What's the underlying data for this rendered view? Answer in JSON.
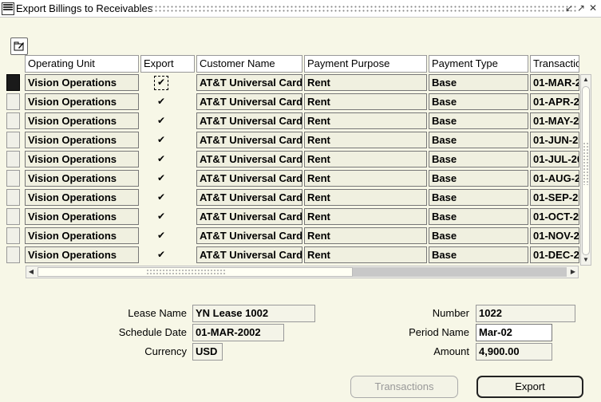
{
  "window": {
    "title": "Export Billings to Receivables",
    "minimize_glyph": "↙",
    "maximize_glyph": "↗",
    "close_glyph": "✕"
  },
  "toolbar": {
    "folder_icon": "folder-tools-icon"
  },
  "table": {
    "columns": [
      "Operating Unit",
      "Export",
      "Customer Name",
      "Payment Purpose",
      "Payment Type",
      "Transactio"
    ],
    "rows": [
      {
        "operating_unit": "Vision Operations",
        "export": true,
        "customer_name": "AT&T Universal Card",
        "payment_purpose": "Rent",
        "payment_type": "Base",
        "transaction_date": "01-MAR-2"
      },
      {
        "operating_unit": "Vision Operations",
        "export": true,
        "customer_name": "AT&T Universal Card",
        "payment_purpose": "Rent",
        "payment_type": "Base",
        "transaction_date": "01-APR-20"
      },
      {
        "operating_unit": "Vision Operations",
        "export": true,
        "customer_name": "AT&T Universal Card",
        "payment_purpose": "Rent",
        "payment_type": "Base",
        "transaction_date": "01-MAY-20"
      },
      {
        "operating_unit": "Vision Operations",
        "export": true,
        "customer_name": "AT&T Universal Card",
        "payment_purpose": "Rent",
        "payment_type": "Base",
        "transaction_date": "01-JUN-20"
      },
      {
        "operating_unit": "Vision Operations",
        "export": true,
        "customer_name": "AT&T Universal Card",
        "payment_purpose": "Rent",
        "payment_type": "Base",
        "transaction_date": "01-JUL-20"
      },
      {
        "operating_unit": "Vision Operations",
        "export": true,
        "customer_name": "AT&T Universal Card",
        "payment_purpose": "Rent",
        "payment_type": "Base",
        "transaction_date": "01-AUG-20"
      },
      {
        "operating_unit": "Vision Operations",
        "export": true,
        "customer_name": "AT&T Universal Card",
        "payment_purpose": "Rent",
        "payment_type": "Base",
        "transaction_date": "01-SEP-20"
      },
      {
        "operating_unit": "Vision Operations",
        "export": true,
        "customer_name": "AT&T Universal Card",
        "payment_purpose": "Rent",
        "payment_type": "Base",
        "transaction_date": "01-OCT-20"
      },
      {
        "operating_unit": "Vision Operations",
        "export": true,
        "customer_name": "AT&T Universal Card",
        "payment_purpose": "Rent",
        "payment_type": "Base",
        "transaction_date": "01-NOV-20"
      },
      {
        "operating_unit": "Vision Operations",
        "export": true,
        "customer_name": "AT&T Universal Card",
        "payment_purpose": "Rent",
        "payment_type": "Base",
        "transaction_date": "01-DEC-20"
      }
    ]
  },
  "form": {
    "lease_name_label": "Lease Name",
    "lease_name": "YN Lease 1002",
    "number_label": "Number",
    "number": "1022",
    "schedule_date_label": "Schedule Date",
    "schedule_date": "01-MAR-2002",
    "period_name_label": "Period Name",
    "period_name": "Mar-02",
    "currency_label": "Currency",
    "currency": "USD",
    "amount_label": "Amount",
    "amount": "4,900.00"
  },
  "buttons": {
    "transactions": "Transactions",
    "export": "Export"
  },
  "check_glyph": "✔"
}
